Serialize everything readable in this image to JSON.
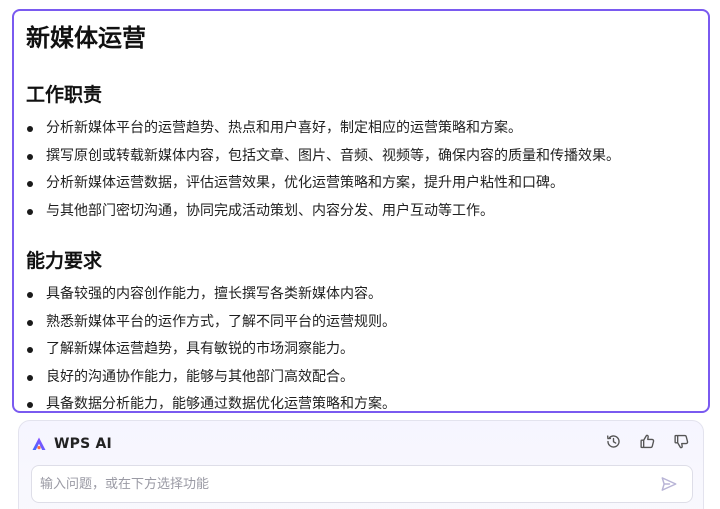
{
  "document": {
    "title": "新媒体运营",
    "sections": [
      {
        "heading": "工作职责",
        "items": [
          "分析新媒体平台的运营趋势、热点和用户喜好，制定相应的运营策略和方案。",
          "撰写原创或转载新媒体内容，包括文章、图片、音频、视频等，确保内容的质量和传播效果。",
          "分析新媒体运营数据，评估运营效果，优化运营策略和方案，提升用户粘性和口碑。",
          "与其他部门密切沟通，协同完成活动策划、内容分发、用户互动等工作。"
        ]
      },
      {
        "heading": "能力要求",
        "items": [
          "具备较强的内容创作能力，擅长撰写各类新媒体内容。",
          "熟悉新媒体平台的运作方式，了解不同平台的运营规则。",
          "了解新媒体运营趋势，具有敏锐的市场洞察能力。",
          "良好的沟通协作能力，能够与其他部门高效配合。",
          "具备数据分析能力，能够通过数据优化运营策略和方案。"
        ]
      }
    ]
  },
  "ai_panel": {
    "name": "WPS AI",
    "input_value": "",
    "input_placeholder": "输入问题，或在下方选择功能",
    "icons": {
      "logo": "wps-ai-logo-icon",
      "history": "history-icon",
      "like": "thumbs-up-icon",
      "dislike": "thumbs-down-icon",
      "send": "send-icon"
    },
    "colors": {
      "accent": "#7a5af0",
      "icon": "#555555",
      "send": "#b8b4d6"
    }
  }
}
